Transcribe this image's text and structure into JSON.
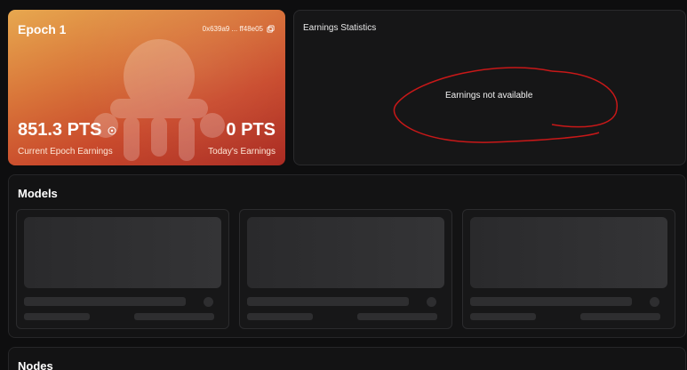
{
  "epoch": {
    "title": "Epoch 1",
    "wallet": "0x639a9 ... ff48e05",
    "current_pts": "851.3 PTS",
    "current_label": "Current Epoch Earnings",
    "today_pts": "0 PTS",
    "today_label": "Today's Earnings"
  },
  "stats": {
    "title": "Earnings Statistics",
    "empty_message": "Earnings not available"
  },
  "models": {
    "title": "Models",
    "placeholders": 3
  },
  "nodes": {
    "title": "Nodes"
  },
  "colors": {
    "accent_start": "#e7a84f",
    "accent_end": "#a92a22",
    "annotation": "#c81818"
  }
}
